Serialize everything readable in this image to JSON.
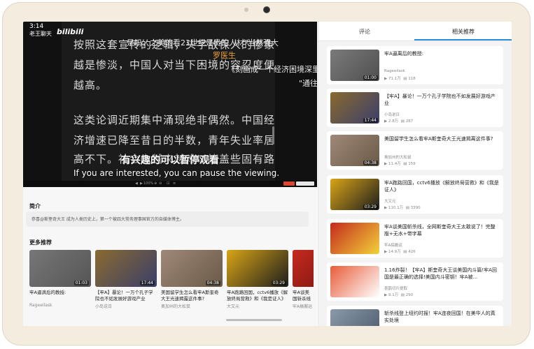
{
  "video": {
    "status_time": "3:14",
    "channel_name": "老王聊天",
    "logo": "bilibili",
    "doc_lines": [
      "按照这套宣传的逻辑，头字敌保人的惨象",
      "越是惨淡，中国人对当下困境的容忍度便",
      "越高。",
      "这类论调近期集中涌现绝非偶然。中国经",
      "济增速已降至昔日的半数，青年失业率居",
      "高不下。社会上越来越难以掩盖些固有路"
    ],
    "overlay_lines": [
      "是吗，之美的看21世纪是贵的人材\"当然强大",
      "《刻画成一个经济困境深里",
      "\"通往"
    ],
    "overlay_name": "罗医生",
    "subtitle_cn": "有兴趣的可以暂停观看",
    "subtitle_en": "If you are interested, you can pause the viewing.",
    "controls": [
      "◀",
      "▶",
      "100%",
      "⊕",
      "⊖",
      "⊡",
      "≡"
    ]
  },
  "intro": {
    "title": "简介",
    "text": "恭喜@斯奎奇大王 成为人类历史上，第一个被四大常务理事国官方的自媒体博主。"
  },
  "more": {
    "title": "更多推荐",
    "items": [
      {
        "title": "牢A逼滴后的教授:",
        "author": "Rageeilask",
        "duration": "01:03",
        "bg": "#6d6d6d"
      },
      {
        "title": "【牢A】暴论！一万个孔子学院也不如发展好游戏产业",
        "author": "小岛说日",
        "duration": "17:44",
        "bg": "#7a5a2a"
      },
      {
        "title": "美国留学生怎么看牢A斯奎奇大王光速揭露这件事?",
        "author": "奥加州的大松鼠",
        "duration": "04:38",
        "bg": "#8a7360"
      },
      {
        "title": "牢A跑路回国，cctv6播放《解放终局营救》和《我是证人》",
        "author": "大又元",
        "duration": "03:29",
        "bg": "#b88a10"
      },
      {
        "title": "牢A谈美国斩杀线",
        "author": "牢A搞搬运",
        "duration": "",
        "bg": "#b3261e"
      }
    ]
  },
  "tabs": {
    "comments": "评论",
    "related": "相关推荐"
  },
  "related": [
    {
      "title": "牢A逼离后的教授:",
      "author": "Rageeilask",
      "views": "▶ 71.1万",
      "comments": "118",
      "duration": "01:00",
      "bg": "#707070"
    },
    {
      "title": "【牢A】暴论！一万个孔子学院也不如发展好游戏产业",
      "author": "小岛说日",
      "views": "▶ 2.8万",
      "comments": "287",
      "duration": "17:44",
      "bg": "#7a5a2a"
    },
    {
      "title": "美国留学生怎么看牢A斯奎奇大王光速揭离这件事?",
      "author": "奥加州的大松鼠",
      "views": "▶ 11.4万",
      "comments": "159",
      "duration": "04:38",
      "bg": "#8a7360"
    },
    {
      "title": "牢A跑路回国，cctv6播放《解放终局营救》和《我是证人》",
      "author": "大又元",
      "views": "▶ 110.1万",
      "comments": "3390",
      "duration": "03:29",
      "bg": "#b88a10"
    },
    {
      "title": "牢A谈美国斩杀线，全网斯奎奇大王太敢说了！完整版+无水+带字幕",
      "author": "牢A搞搬运",
      "views": "▶ 14.9万",
      "comments": "426",
      "duration": "",
      "bg": "#b3261e"
    },
    {
      "title": "1.16炸裂！【牢A】斯奎奇大王谈美国内斗篇!牢A回国是最正确的选择!美国内斗密钥！牢A被...",
      "author": "喜鹊切片提取",
      "views": "▶ 9.1万",
      "comments": "290",
      "duration": "",
      "bg": "#c97a2a"
    },
    {
      "title": "斩杀线登上纽约时报！牢A连夜回国！在美华人的真实处境",
      "author": "",
      "views": "",
      "comments": "",
      "duration": "",
      "bg": "#6a7a8a"
    }
  ]
}
